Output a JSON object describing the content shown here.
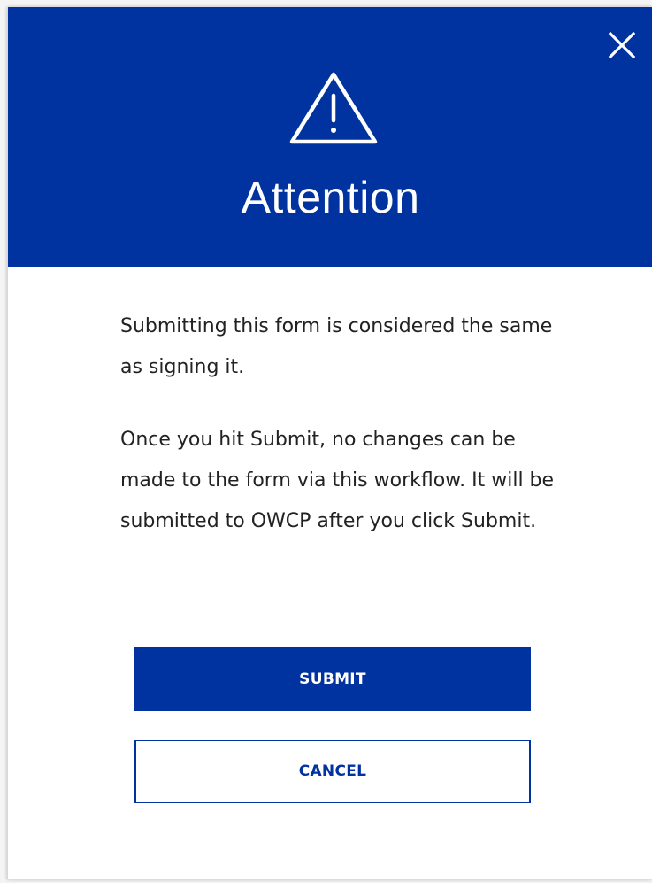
{
  "dialog": {
    "title": "Attention",
    "icons": {
      "warning": "warning-triangle-icon",
      "close": "close-icon"
    },
    "paragraphs": [
      "Submitting this form is considered the same as signing it.",
      "Once you hit Submit, no changes can be made to the form via this workflow. It will be submitted to OWCP after you click Submit."
    ],
    "buttons": {
      "submit_label": "SUBMIT",
      "cancel_label": "CANCEL"
    }
  },
  "colors": {
    "primary": "#0033a0",
    "header_text": "#ffffff",
    "body_text": "#222222",
    "background": "#ffffff"
  }
}
